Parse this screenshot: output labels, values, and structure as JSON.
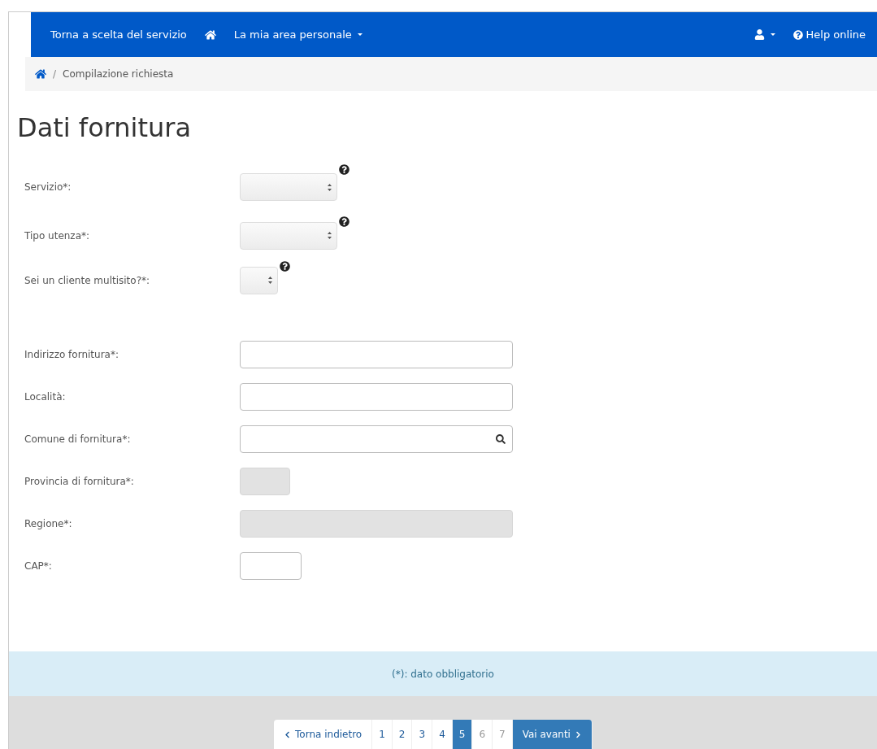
{
  "navbar": {
    "back_link": "Torna a scelta del servizio",
    "area_menu": "La mia area personale",
    "help": "Help online"
  },
  "breadcrumb": {
    "separator": "/",
    "current": "Compilazione richiesta"
  },
  "title": "Dati fornitura",
  "selects": [
    {
      "label": "Servizio*:",
      "kind": "select"
    },
    {
      "label": "Tipo utenza*:",
      "kind": "select"
    },
    {
      "label": "Sei un cliente multisito?*:",
      "kind": "narrow"
    }
  ],
  "fields": [
    {
      "label": "Indirizzo fornitura*:",
      "kind": "text",
      "disabled": false
    },
    {
      "label": "Località:",
      "kind": "text",
      "disabled": false
    },
    {
      "label": "Comune di fornitura*:",
      "kind": "search",
      "disabled": false
    },
    {
      "label": "Provincia di fornitura*:",
      "kind": "small",
      "disabled": true
    },
    {
      "label": "Regione*:",
      "kind": "text",
      "disabled": true
    },
    {
      "label": "CAP*:",
      "kind": "short",
      "disabled": false
    }
  ],
  "note": "(*): dato obbligatorio",
  "pagination": {
    "previous": "Torna indietro",
    "next": "Vai avanti",
    "pages": [
      {
        "label": "1",
        "selected": false,
        "disabled": false
      },
      {
        "label": "2",
        "selected": false,
        "disabled": false
      },
      {
        "label": "3",
        "selected": false,
        "disabled": false
      },
      {
        "label": "4",
        "selected": false,
        "disabled": false
      },
      {
        "label": "5",
        "selected": true,
        "disabled": false
      },
      {
        "label": "6",
        "selected": false,
        "disabled": true
      },
      {
        "label": "7",
        "selected": false,
        "disabled": true
      }
    ]
  }
}
